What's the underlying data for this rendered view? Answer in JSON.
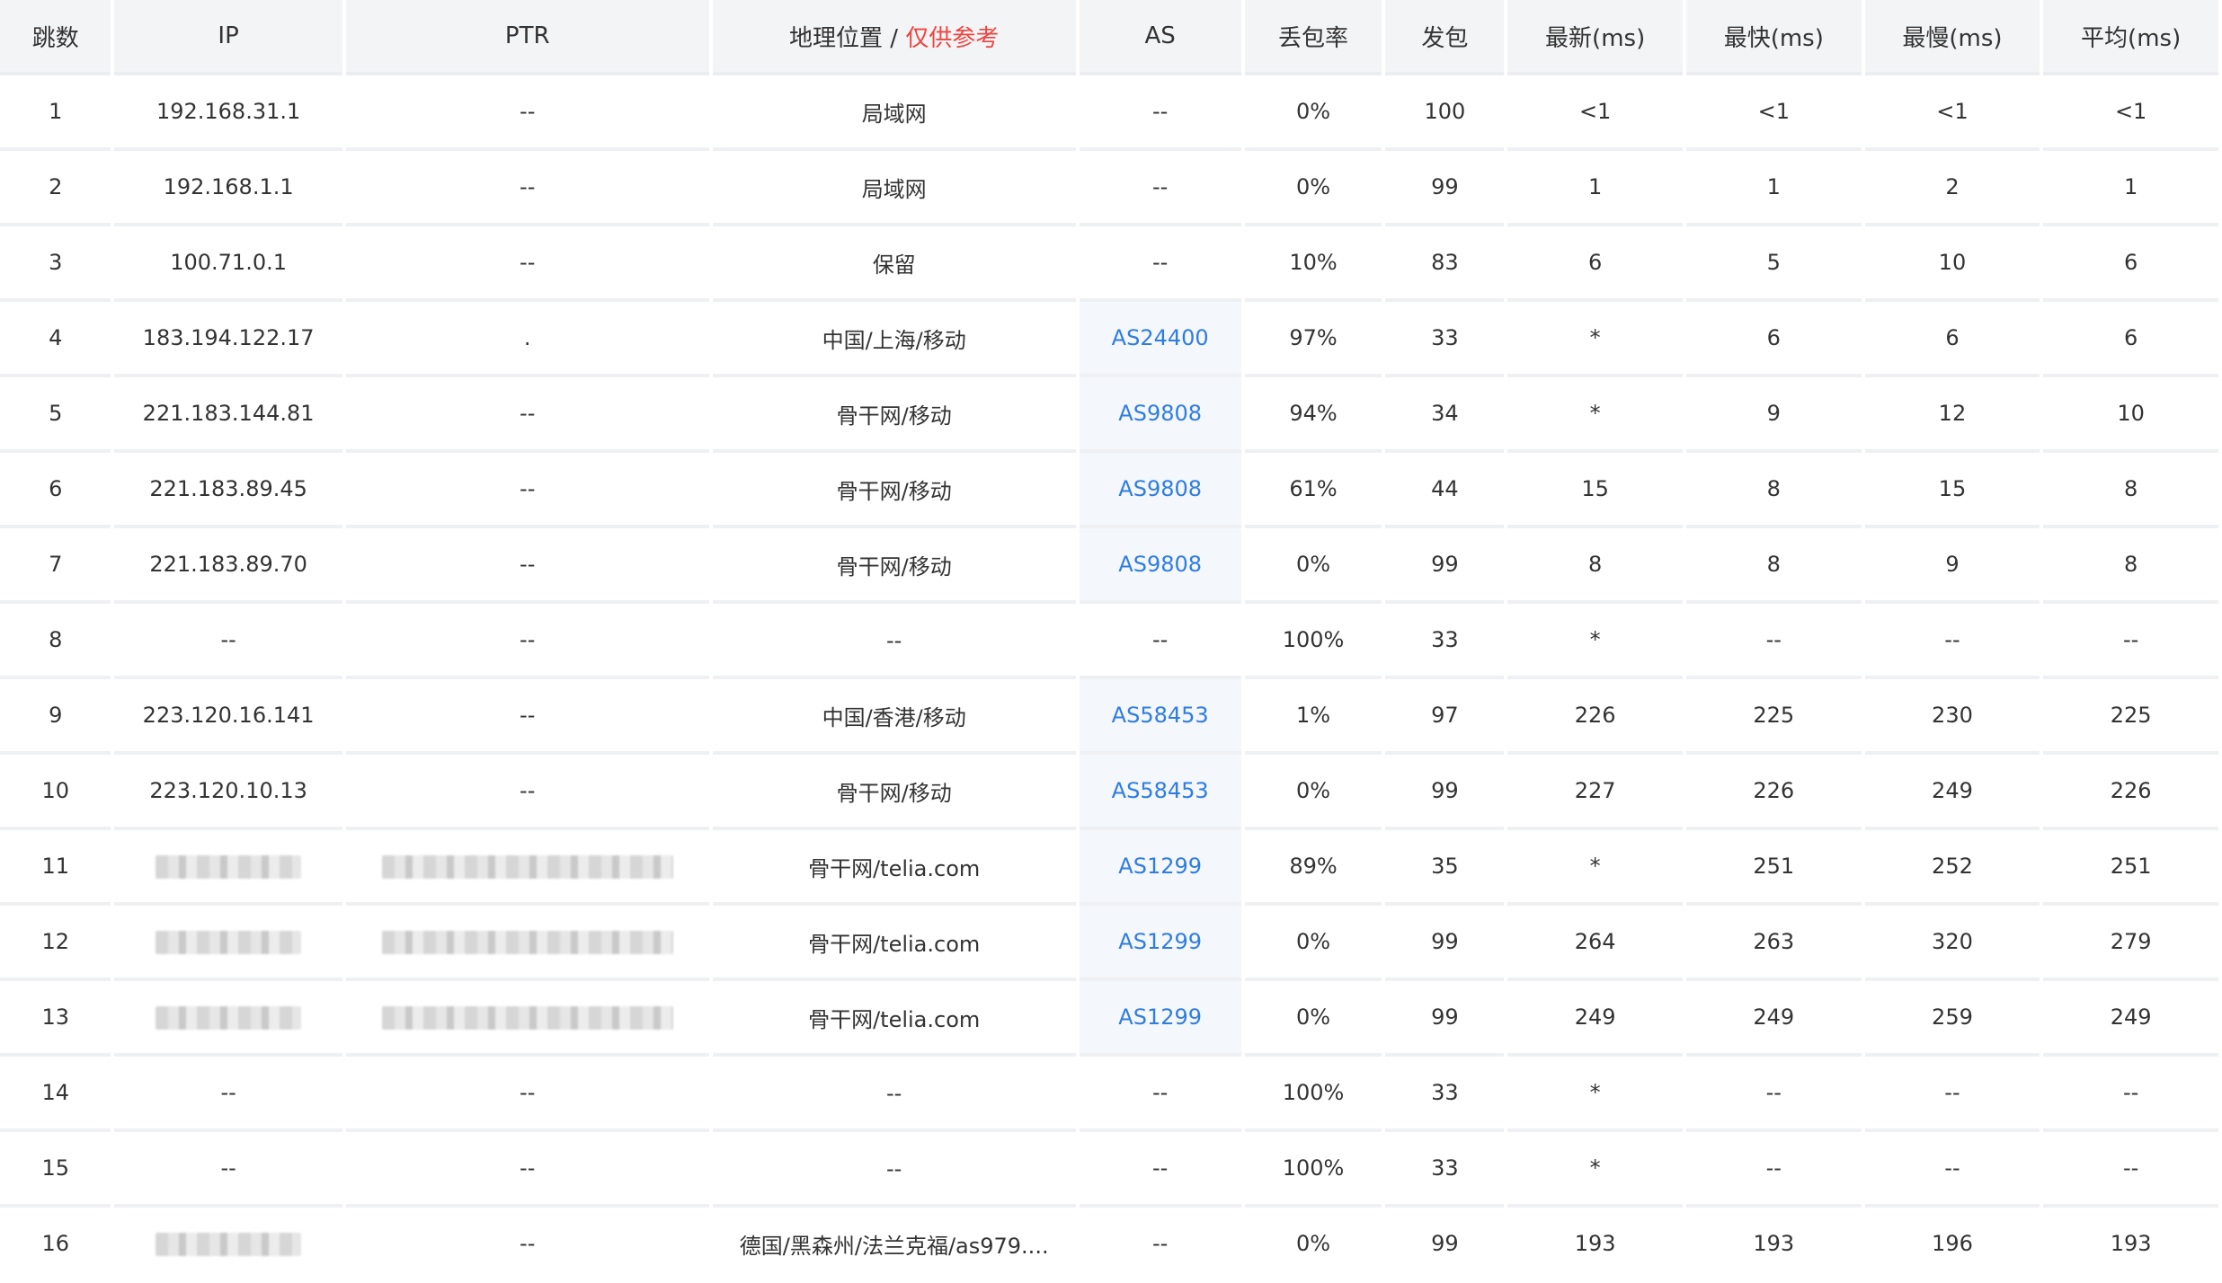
{
  "headers": {
    "hop": "跳数",
    "ip": "IP",
    "ptr": "PTR",
    "geo": "地理位置 / ",
    "geo_note": "仅供参考",
    "as": "AS",
    "loss": "丢包率",
    "sent": "发包",
    "last": "最新(ms)",
    "best": "最快(ms)",
    "worst": "最慢(ms)",
    "avg": "平均(ms)"
  },
  "rows": [
    {
      "hop": "1",
      "ip": "192.168.31.1",
      "ptr": "--",
      "geo": "局域网",
      "as": "--",
      "loss": "0%",
      "sent": "100",
      "last": "<1",
      "best": "<1",
      "worst": "<1",
      "avg": "<1"
    },
    {
      "hop": "2",
      "ip": "192.168.1.1",
      "ptr": "--",
      "geo": "局域网",
      "as": "--",
      "loss": "0%",
      "sent": "99",
      "last": "1",
      "best": "1",
      "worst": "2",
      "avg": "1"
    },
    {
      "hop": "3",
      "ip": "100.71.0.1",
      "ptr": "--",
      "geo": "保留",
      "as": "--",
      "loss": "10%",
      "sent": "83",
      "last": "6",
      "best": "5",
      "worst": "10",
      "avg": "6"
    },
    {
      "hop": "4",
      "ip": "183.194.122.17",
      "ptr": ".",
      "geo": "中国/上海/移动",
      "as": "AS24400",
      "loss": "97%",
      "sent": "33",
      "last": "*",
      "best": "6",
      "worst": "6",
      "avg": "6"
    },
    {
      "hop": "5",
      "ip": "221.183.144.81",
      "ptr": "--",
      "geo": "骨干网/移动",
      "as": "AS9808",
      "loss": "94%",
      "sent": "34",
      "last": "*",
      "best": "9",
      "worst": "12",
      "avg": "10"
    },
    {
      "hop": "6",
      "ip": "221.183.89.45",
      "ptr": "--",
      "geo": "骨干网/移动",
      "as": "AS9808",
      "loss": "61%",
      "sent": "44",
      "last": "15",
      "best": "8",
      "worst": "15",
      "avg": "8"
    },
    {
      "hop": "7",
      "ip": "221.183.89.70",
      "ptr": "--",
      "geo": "骨干网/移动",
      "as": "AS9808",
      "loss": "0%",
      "sent": "99",
      "last": "8",
      "best": "8",
      "worst": "9",
      "avg": "8"
    },
    {
      "hop": "8",
      "ip": "--",
      "ptr": "--",
      "geo": "--",
      "as": "--",
      "loss": "100%",
      "sent": "33",
      "last": "*",
      "best": "--",
      "worst": "--",
      "avg": "--"
    },
    {
      "hop": "9",
      "ip": "223.120.16.141",
      "ptr": "--",
      "geo": "中国/香港/移动",
      "as": "AS58453",
      "loss": "1%",
      "sent": "97",
      "last": "226",
      "best": "225",
      "worst": "230",
      "avg": "225"
    },
    {
      "hop": "10",
      "ip": "223.120.10.13",
      "ptr": "--",
      "geo": "骨干网/移动",
      "as": "AS58453",
      "loss": "0%",
      "sent": "99",
      "last": "227",
      "best": "226",
      "worst": "249",
      "avg": "226"
    },
    {
      "hop": "11",
      "ip": "",
      "ptr": "",
      "geo": "骨干网/telia.com",
      "as": "AS1299",
      "loss": "89%",
      "sent": "35",
      "last": "*",
      "best": "251",
      "worst": "252",
      "avg": "251"
    },
    {
      "hop": "12",
      "ip": "",
      "ptr": "",
      "geo": "骨干网/telia.com",
      "as": "AS1299",
      "loss": "0%",
      "sent": "99",
      "last": "264",
      "best": "263",
      "worst": "320",
      "avg": "279"
    },
    {
      "hop": "13",
      "ip": "",
      "ptr": "",
      "geo": "骨干网/telia.com",
      "as": "AS1299",
      "loss": "0%",
      "sent": "99",
      "last": "249",
      "best": "249",
      "worst": "259",
      "avg": "249"
    },
    {
      "hop": "14",
      "ip": "--",
      "ptr": "--",
      "geo": "--",
      "as": "--",
      "loss": "100%",
      "sent": "33",
      "last": "*",
      "best": "--",
      "worst": "--",
      "avg": "--"
    },
    {
      "hop": "15",
      "ip": "--",
      "ptr": "--",
      "geo": "--",
      "as": "--",
      "loss": "100%",
      "sent": "33",
      "last": "*",
      "best": "--",
      "worst": "--",
      "avg": "--"
    },
    {
      "hop": "16",
      "ip": "",
      "ptr": "--",
      "geo": "德国/黑森州/法兰克福/as979....",
      "as": "--",
      "loss": "0%",
      "sent": "99",
      "last": "193",
      "best": "193",
      "worst": "196",
      "avg": "193"
    }
  ],
  "colors": {
    "header_bg": "#f3f4f6",
    "as_cell_bg": "#f4f7fb",
    "link": "#2f7de1",
    "note_red": "#f0433f"
  }
}
